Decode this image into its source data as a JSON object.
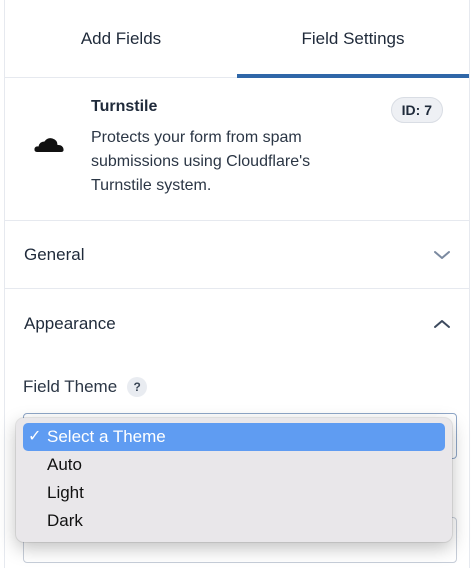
{
  "tabs": [
    {
      "label": "Add Fields",
      "active": false
    },
    {
      "label": "Field Settings",
      "active": true
    }
  ],
  "field": {
    "title": "Turnstile",
    "description": "Protects your form from spam submissions using Cloudflare's Turnstile system.",
    "id_badge": "ID: 7",
    "icon": "cloudflare-cloud-icon"
  },
  "sections": {
    "general": {
      "title": "General",
      "icon": "chevron-down-icon"
    },
    "appearance": {
      "title": "Appearance",
      "icon": "chevron-up-icon"
    }
  },
  "field_theme": {
    "label": "Field Theme",
    "help": "?",
    "selected_check": "✓",
    "options": [
      "Select a Theme",
      "Auto",
      "Light",
      "Dark"
    ],
    "selected_index": 0
  },
  "colors": {
    "accent": "#2f67a8",
    "option_highlight": "#5f9cf2"
  }
}
